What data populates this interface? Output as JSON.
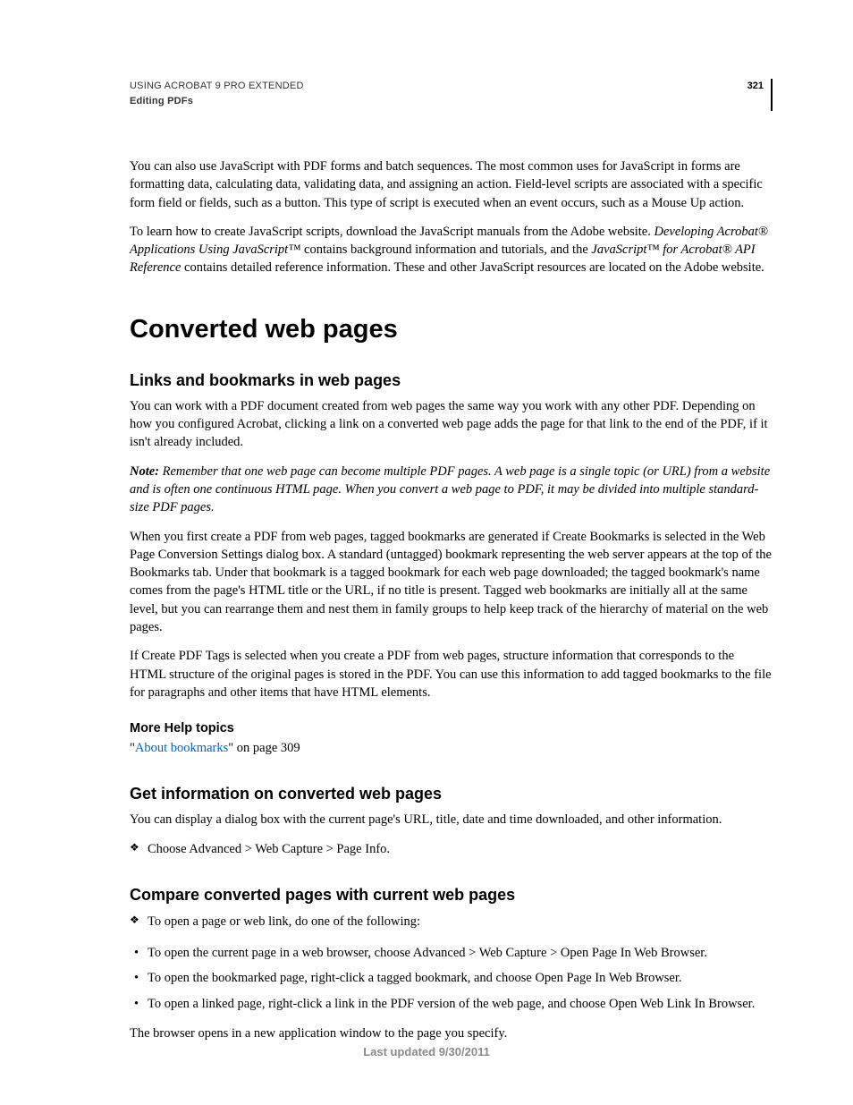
{
  "header": {
    "line1": "USING ACROBAT 9 PRO EXTENDED",
    "line2": "Editing PDFs",
    "pageno": "321"
  },
  "intro": {
    "p1": "You can also use JavaScript with PDF forms and batch sequences. The most common uses for JavaScript in forms are formatting data, calculating data, validating data, and assigning an action. Field-level scripts are associated with a specific form field or fields, such as a button. This type of script is executed when an event occurs, such as a Mouse Up action.",
    "p2a": "To learn how to create JavaScript scripts, download the JavaScript manuals from the Adobe website. ",
    "p2b": "Developing Acrobat® Applications Using JavaScript™",
    "p2c": " contains background information and tutorials, and the ",
    "p2d": "JavaScript™ for Acrobat® API Reference",
    "p2e": " contains detailed reference information. These and other JavaScript resources are located on the Adobe website."
  },
  "h1": "Converted web pages",
  "sec1": {
    "h2": "Links and bookmarks in web pages",
    "p1": "You can work with a PDF document created from web pages the same way you work with any other PDF. Depending on how you configured Acrobat, clicking a link on a converted web page adds the page for that link to the end of the PDF, if it isn't already included.",
    "note_label": "Note:",
    "note_body": " Remember that one web page can become multiple PDF pages. A web page is a single topic (or URL) from a website and is often one continuous HTML page. When you convert a web page to PDF, it may be divided into multiple standard-size PDF pages.",
    "p2": "When you first create a PDF from web pages, tagged bookmarks are generated if Create Bookmarks is selected in the Web Page Conversion Settings dialog box. A standard (untagged) bookmark representing the web server appears at the top of the Bookmarks tab. Under that bookmark is a tagged bookmark for each web page downloaded; the tagged bookmark's name comes from the page's HTML title or the URL, if no title is present. Tagged web bookmarks are initially all at the same level, but you can rearrange them and nest them in family groups to help keep track of the hierarchy of material on the web pages.",
    "p3": "If Create PDF Tags is selected when you create a PDF from web pages, structure information that corresponds to the HTML structure of the original pages is stored in the PDF. You can use this information to add tagged bookmarks to the file for paragraphs and other items that have HTML elements."
  },
  "morehelp": {
    "h3": "More Help topics",
    "q1": "\"",
    "link": "About bookmarks",
    "rest": "\" on page 309"
  },
  "sec2": {
    "h2": "Get information on converted web pages",
    "p1": "You can display a dialog box with the current page's URL, title, date and time downloaded, and other information.",
    "li1": "Choose Advanced > Web Capture > Page Info."
  },
  "sec3": {
    "h2": "Compare converted pages with current web pages",
    "li1": "To open a page or web link, do one of the following:",
    "b1": "To open the current page in a web browser, choose Advanced > Web Capture > Open Page In Web Browser.",
    "b2": "To open the bookmarked page, right-click a tagged bookmark, and choose Open Page In Web Browser.",
    "b3": "To open a linked page, right-click a link in the PDF version of the web page, and choose Open Web Link In Browser.",
    "p_end": "The browser opens in a new application window to the page you specify."
  },
  "footer": "Last updated 9/30/2011"
}
